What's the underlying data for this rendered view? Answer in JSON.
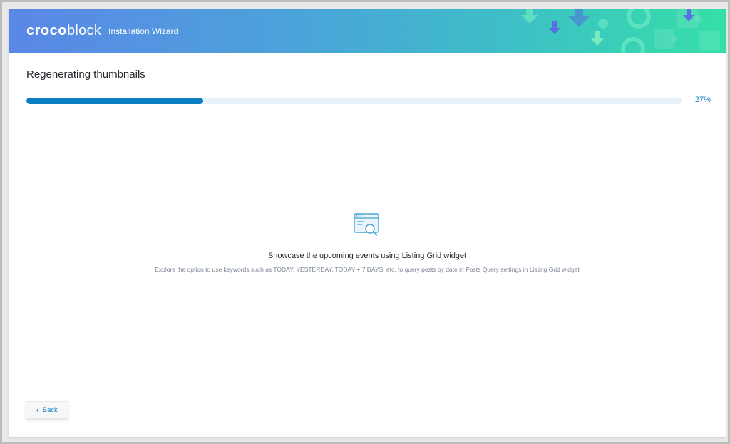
{
  "header": {
    "logo_bold": "croco",
    "logo_light": "block",
    "title": "Installation Wizard"
  },
  "page": {
    "title": "Regenerating thumbnails"
  },
  "progress": {
    "percent": 27,
    "label": "27%"
  },
  "tip": {
    "icon": "browser-search-icon",
    "title": "Showcase the upcoming events using Listing Grid widget",
    "description": "Explore the option to use keywords such as TODAY, YESTERDAY, TODAY + 7 DAYS, etc. to query posts by date in Posts Query settings in Listing Grid widget"
  },
  "footer": {
    "back_label": "Back"
  },
  "colors": {
    "accent": "#0a7ec2",
    "progress_track": "#e6f1f8",
    "header_gradient_start": "#5b87e6",
    "header_gradient_end": "#36dfa7"
  }
}
